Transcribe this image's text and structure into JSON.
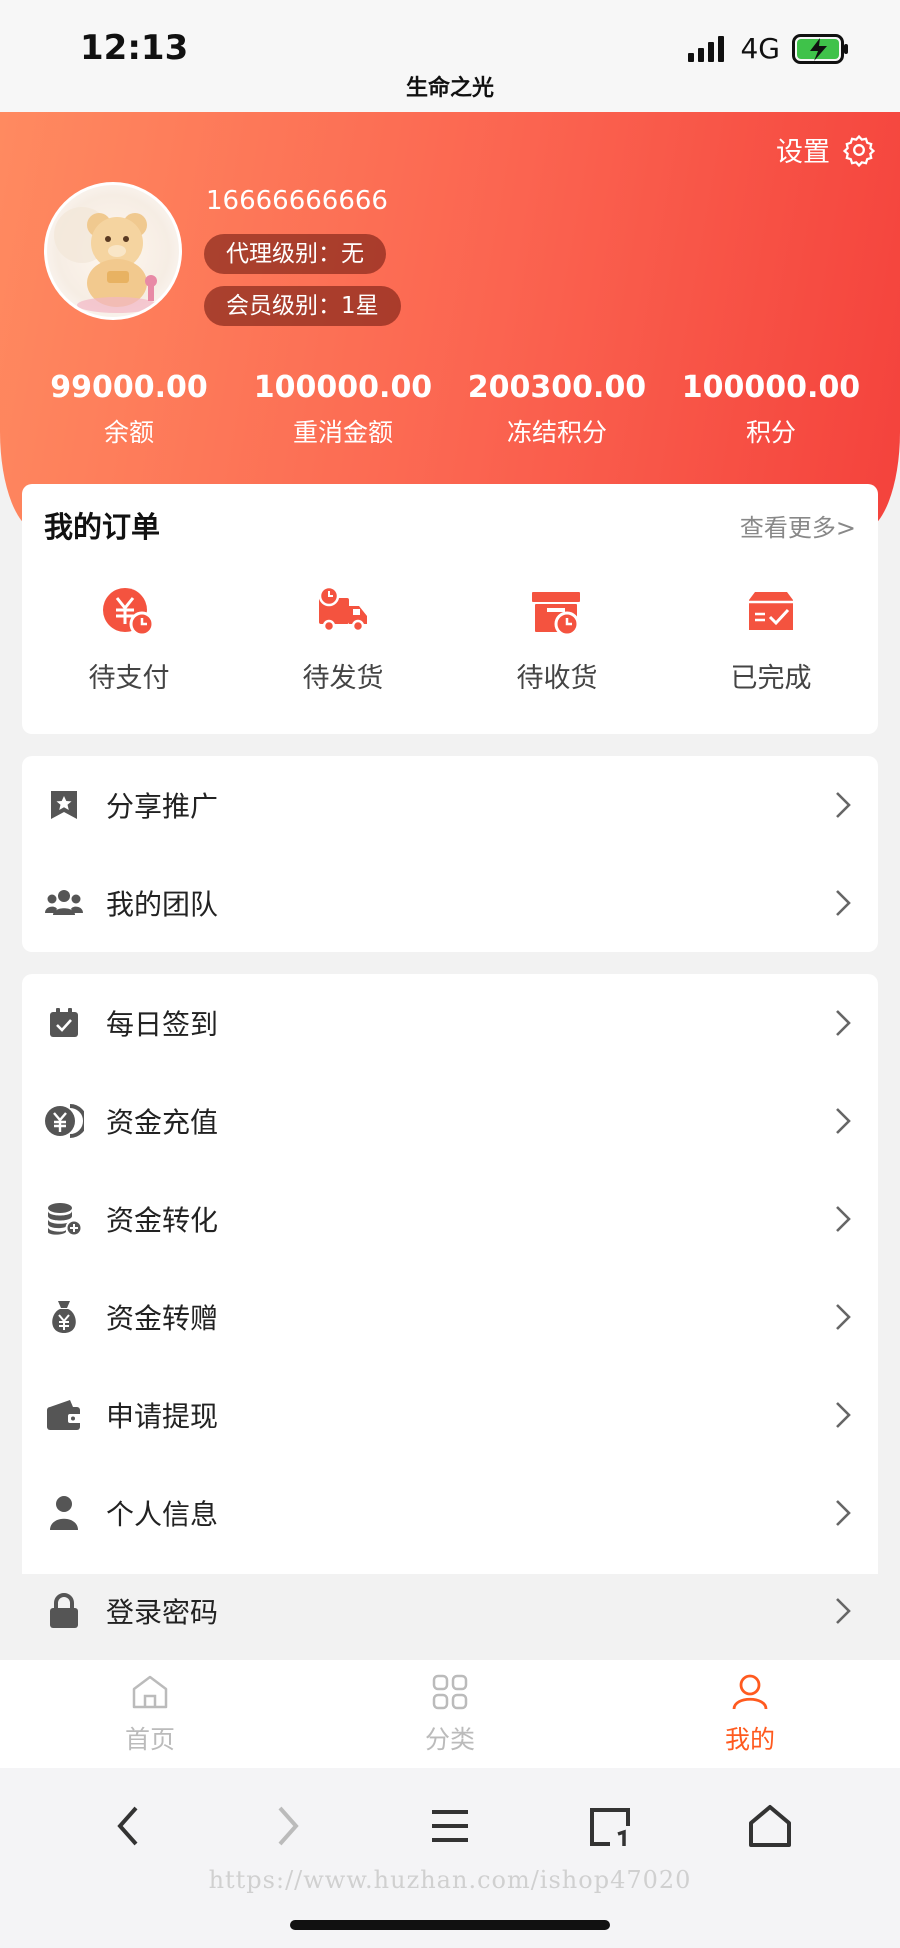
{
  "status_bar": {
    "time": "12:13",
    "network": "4G"
  },
  "page_title": "生命之光",
  "header": {
    "settings_label": "设置",
    "phone": "16666666666",
    "agent_level": "代理级别：无",
    "member_level": "会员级别：1星",
    "stats": [
      {
        "value": "99000.00",
        "label": "余额"
      },
      {
        "value": "100000.00",
        "label": "重消金额"
      },
      {
        "value": "200300.00",
        "label": "冻结积分"
      },
      {
        "value": "100000.00",
        "label": "积分"
      }
    ]
  },
  "orders": {
    "title": "我的订单",
    "more": "查看更多>",
    "items": [
      {
        "label": "待支付",
        "icon": "yuan-clock-icon"
      },
      {
        "label": "待发货",
        "icon": "truck-icon"
      },
      {
        "label": "待收货",
        "icon": "box-clock-icon"
      },
      {
        "label": "已完成",
        "icon": "check-box-icon"
      }
    ]
  },
  "menu_group1": [
    {
      "label": "分享推广",
      "icon": "bookmark-star-icon"
    },
    {
      "label": "我的团队",
      "icon": "team-icon"
    }
  ],
  "menu_group2": [
    {
      "label": "每日签到",
      "icon": "calendar-check-icon"
    },
    {
      "label": "资金充值",
      "icon": "yuan-coin-icon"
    },
    {
      "label": "资金转化",
      "icon": "coin-stack-icon"
    },
    {
      "label": "资金转赠",
      "icon": "money-bag-icon"
    },
    {
      "label": "申请提现",
      "icon": "wallet-icon"
    },
    {
      "label": "个人信息",
      "icon": "person-icon"
    },
    {
      "label": "登录密码",
      "icon": "lock-icon"
    }
  ],
  "tabbar": [
    {
      "label": "首页",
      "icon": "home-icon",
      "active": false
    },
    {
      "label": "分类",
      "icon": "grid-icon",
      "active": false
    },
    {
      "label": "我的",
      "icon": "user-icon",
      "active": true
    }
  ],
  "browser": {
    "watermark": "https://www.huzhan.com/ishop47020"
  },
  "colors": {
    "accent": "#ff5a1f",
    "header_start": "#ff8a60",
    "header_end": "#f4423c",
    "icon_red": "#f4533f"
  }
}
